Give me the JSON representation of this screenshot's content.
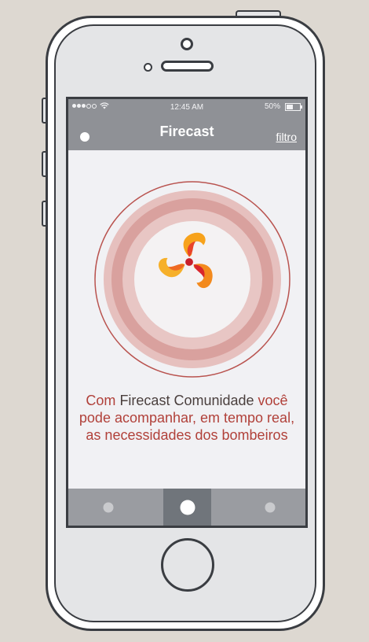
{
  "status_bar": {
    "signal_bars_filled": 3,
    "signal_bars_total": 5,
    "time": "12:45 AM",
    "battery": "50%",
    "battery_level": 0.5
  },
  "nav": {
    "title": "Firecast",
    "filter_label": "filtro"
  },
  "hero": {
    "logo_icon": "firecast-triskelion-icon"
  },
  "message": {
    "part1": "Com ",
    "brand": "Firecast Comunidade",
    "part2": "você pode acompanhar, em tempo real, as necessidades dos bombeiros"
  },
  "tabs": [
    {
      "name": "left",
      "active": false
    },
    {
      "name": "center",
      "active": true
    },
    {
      "name": "right",
      "active": false
    }
  ],
  "colors": {
    "background": "#ddd8d1",
    "bar": "#8f9196",
    "accent_red": "#b1413a",
    "ring_light": "#e8c1bf",
    "ring_mid": "#d9a6a3",
    "flame_orange": "#f28b1e",
    "flame_red": "#d8262d"
  }
}
